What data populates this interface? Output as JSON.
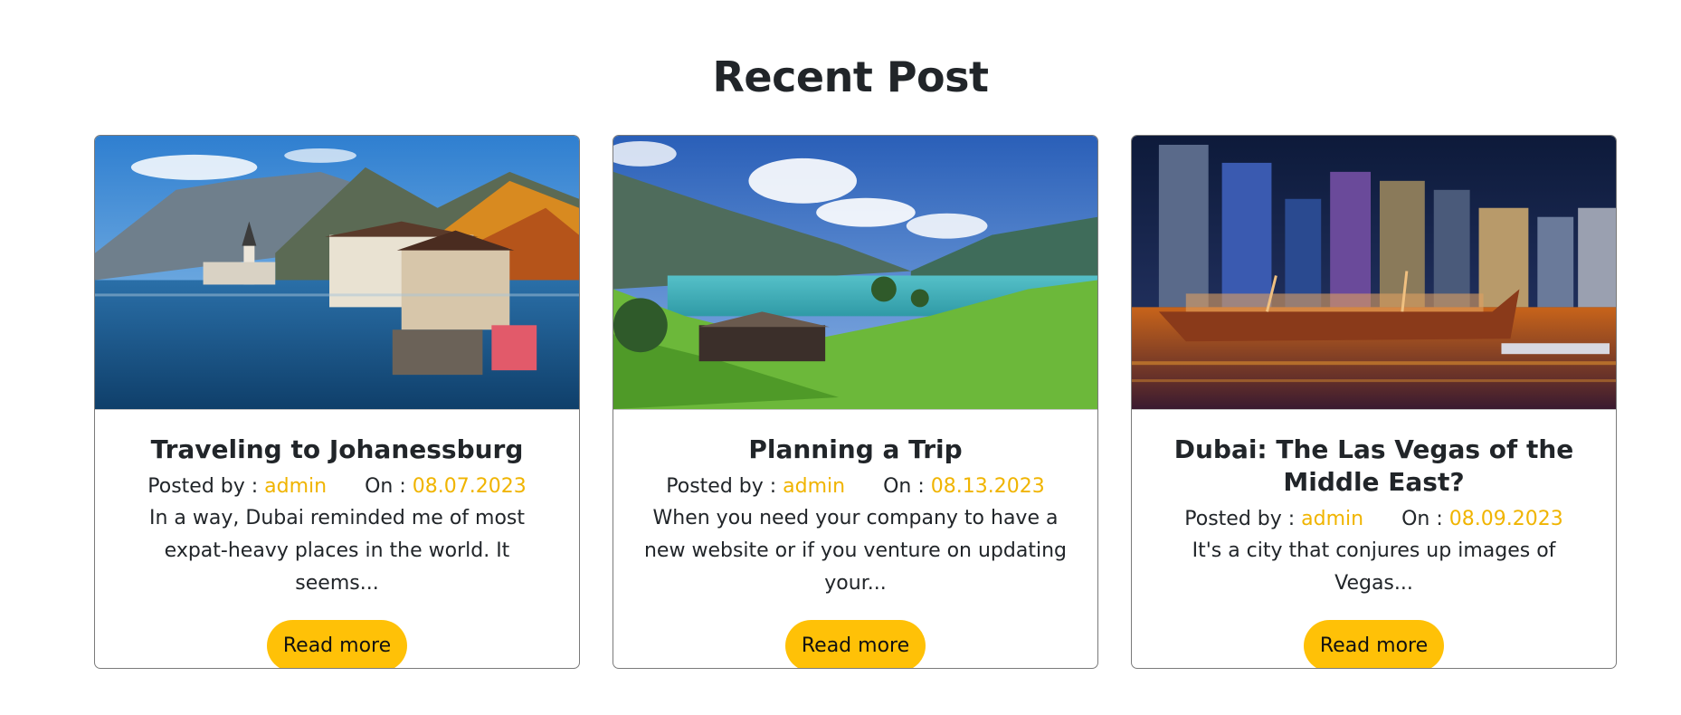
{
  "section": {
    "title": "Recent Post"
  },
  "posts": [
    {
      "image": "lakeside-alpine-village-photo",
      "title": "Traveling to Johanessburg",
      "posted_by_label": "Posted by :",
      "author": "admin",
      "on_label": "On :",
      "date": "08.07.2023",
      "excerpt": "In a way, Dubai reminded me of most expat-heavy places in the world. It seems...",
      "button": "Read more"
    },
    {
      "image": "mountain-lake-meadow-photo",
      "title": "Planning a Trip",
      "posted_by_label": "Posted by :",
      "author": "admin",
      "on_label": "On :",
      "date": "08.13.2023",
      "excerpt": "When you need your company to have a new website or if you venture on updating your...",
      "button": "Read more"
    },
    {
      "image": "dubai-marina-night-photo",
      "title": "Dubai: The Las Vegas of the Middle East?",
      "posted_by_label": "Posted by :",
      "author": "admin",
      "on_label": "On :",
      "date": "08.09.2023",
      "excerpt": "It's a city that conjures up images of Vegas...",
      "button": "Read more"
    }
  ],
  "colors": {
    "accent": "#ffc107",
    "link": "#f0b400",
    "text": "#212529",
    "border": "#7a7a7a"
  }
}
